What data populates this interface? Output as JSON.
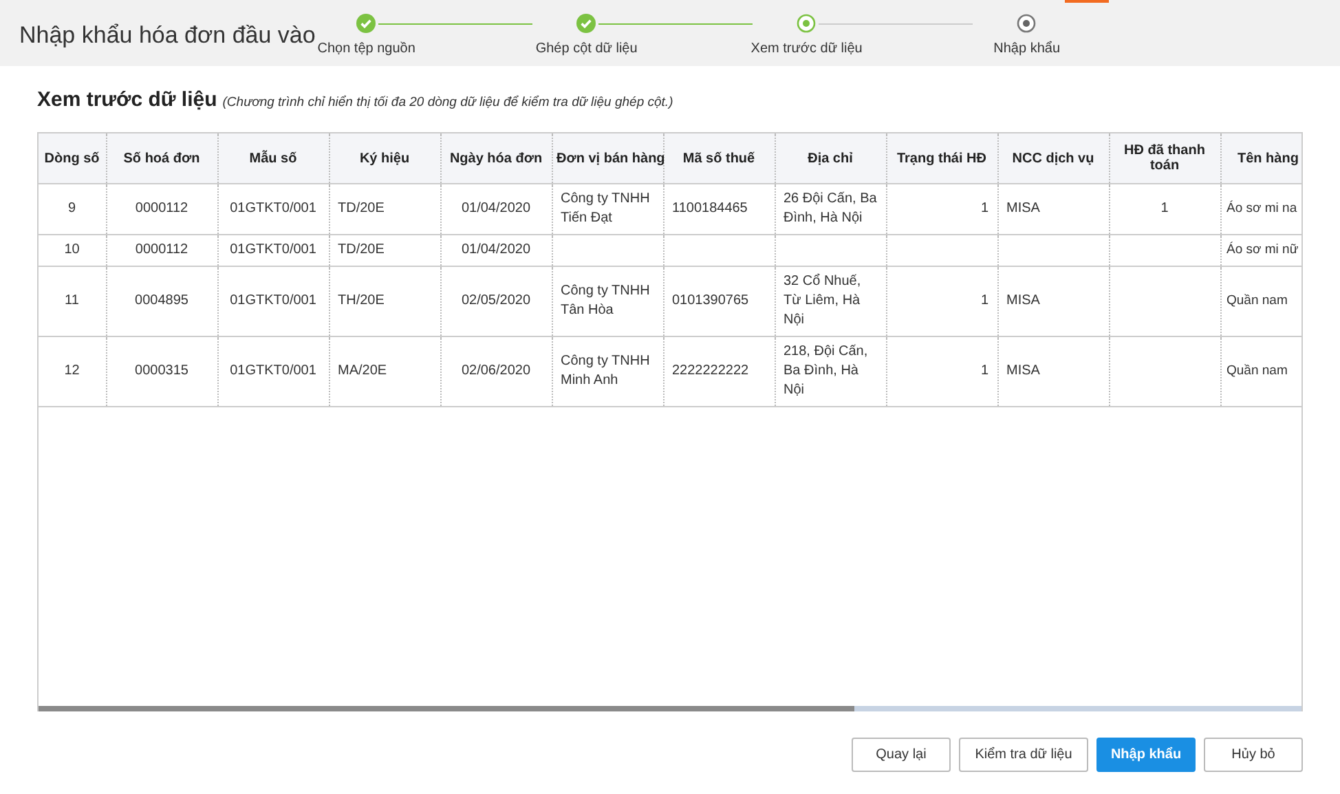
{
  "header": {
    "title": "Nhập khẩu hóa đơn đầu vào"
  },
  "steps": [
    {
      "label": "Chọn tệp nguồn",
      "kind": "done"
    },
    {
      "label": "Ghép cột dữ liệu",
      "kind": "done"
    },
    {
      "label": "Xem trước dữ liệu",
      "kind": "current"
    },
    {
      "label": "Nhập khẩu",
      "kind": "pending"
    }
  ],
  "section": {
    "title": "Xem trước dữ liệu",
    "note": "(Chương trình chỉ hiển thị tối đa 20 dòng dữ liệu để kiểm tra dữ liệu ghép cột.)"
  },
  "table": {
    "columns": [
      "Dòng số",
      "Số hoá đơn",
      "Mẫu số",
      "Ký hiệu",
      "Ngày hóa đơn",
      "Đơn vị bán hàng",
      "Mã số thuế",
      "Địa chỉ",
      "Trạng thái HĐ",
      "NCC dịch vụ",
      "HĐ đã thanh toán",
      "Tên hàng"
    ],
    "rows": [
      [
        "9",
        "0000112",
        "01GTKT0/001",
        "TD/20E",
        "01/04/2020",
        "Công ty TNHH Tiến Đạt",
        "1100184465",
        "26 Đội Cấn, Ba Đình, Hà Nội",
        "1",
        "MISA",
        "1",
        "Áo sơ mi na"
      ],
      [
        "10",
        "0000112",
        "01GTKT0/001",
        "TD/20E",
        "01/04/2020",
        null,
        null,
        null,
        null,
        null,
        null,
        "Áo sơ mi nữ"
      ],
      [
        "11",
        "0004895",
        "01GTKT0/001",
        "TH/20E",
        "02/05/2020",
        "Công ty TNHH Tân Hòa",
        "0101390765",
        "32 Cổ Nhuế, Từ Liêm, Hà Nội",
        "1",
        "MISA",
        null,
        "Quần nam"
      ],
      [
        "12",
        "0000315",
        "01GTKT0/001",
        "MA/20E",
        "02/06/2020",
        "Công ty TNHH Minh Anh",
        "2222222222",
        "218, Đội Cấn, Ba Đình, Hà Nội",
        "1",
        "MISA",
        null,
        "Quần nam"
      ]
    ]
  },
  "buttons": [
    {
      "label": "Quay lại",
      "kind": "secondary"
    },
    {
      "label": "Kiểm tra dữ liệu",
      "kind": "secondary"
    },
    {
      "label": "Nhập khẩu",
      "kind": "primary"
    },
    {
      "label": "Hủy bỏ",
      "kind": "secondary"
    }
  ]
}
